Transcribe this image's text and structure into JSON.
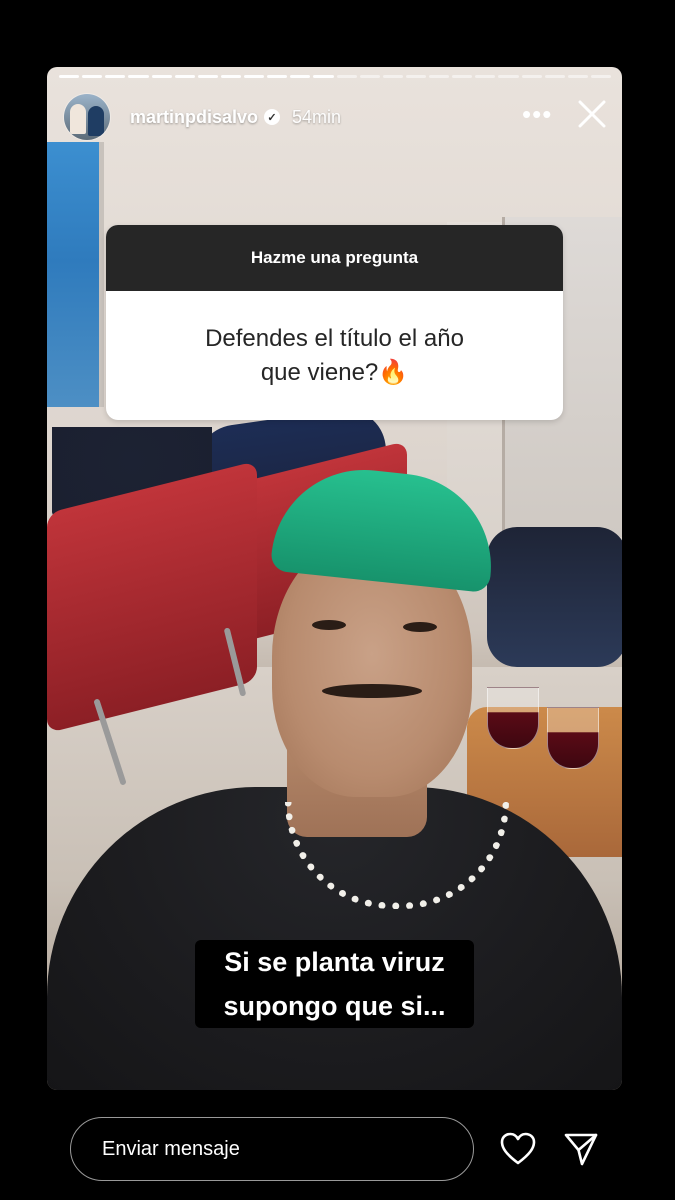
{
  "story": {
    "progress_segments_total": 24,
    "progress_segments_done": 12
  },
  "header": {
    "username": "martinpdisalvo",
    "verified": true,
    "time_ago": "54min",
    "more_icon": "ellipsis-icon",
    "close_icon": "close-icon"
  },
  "question_sticker": {
    "prompt": "Hazme una pregunta",
    "question": "Defendes el título el año\nque viene?🔥"
  },
  "caption": {
    "text": "Si se planta viruz\nsupongo que si..."
  },
  "footer": {
    "message_placeholder": "Enviar mensaje",
    "like_icon": "heart-icon",
    "share_icon": "send-icon"
  },
  "colors": {
    "background": "#000000",
    "sticker_header": "#262626",
    "sticker_body": "#ffffff",
    "cap_green": "#1fae7e",
    "chair_red": "#b02d33"
  }
}
